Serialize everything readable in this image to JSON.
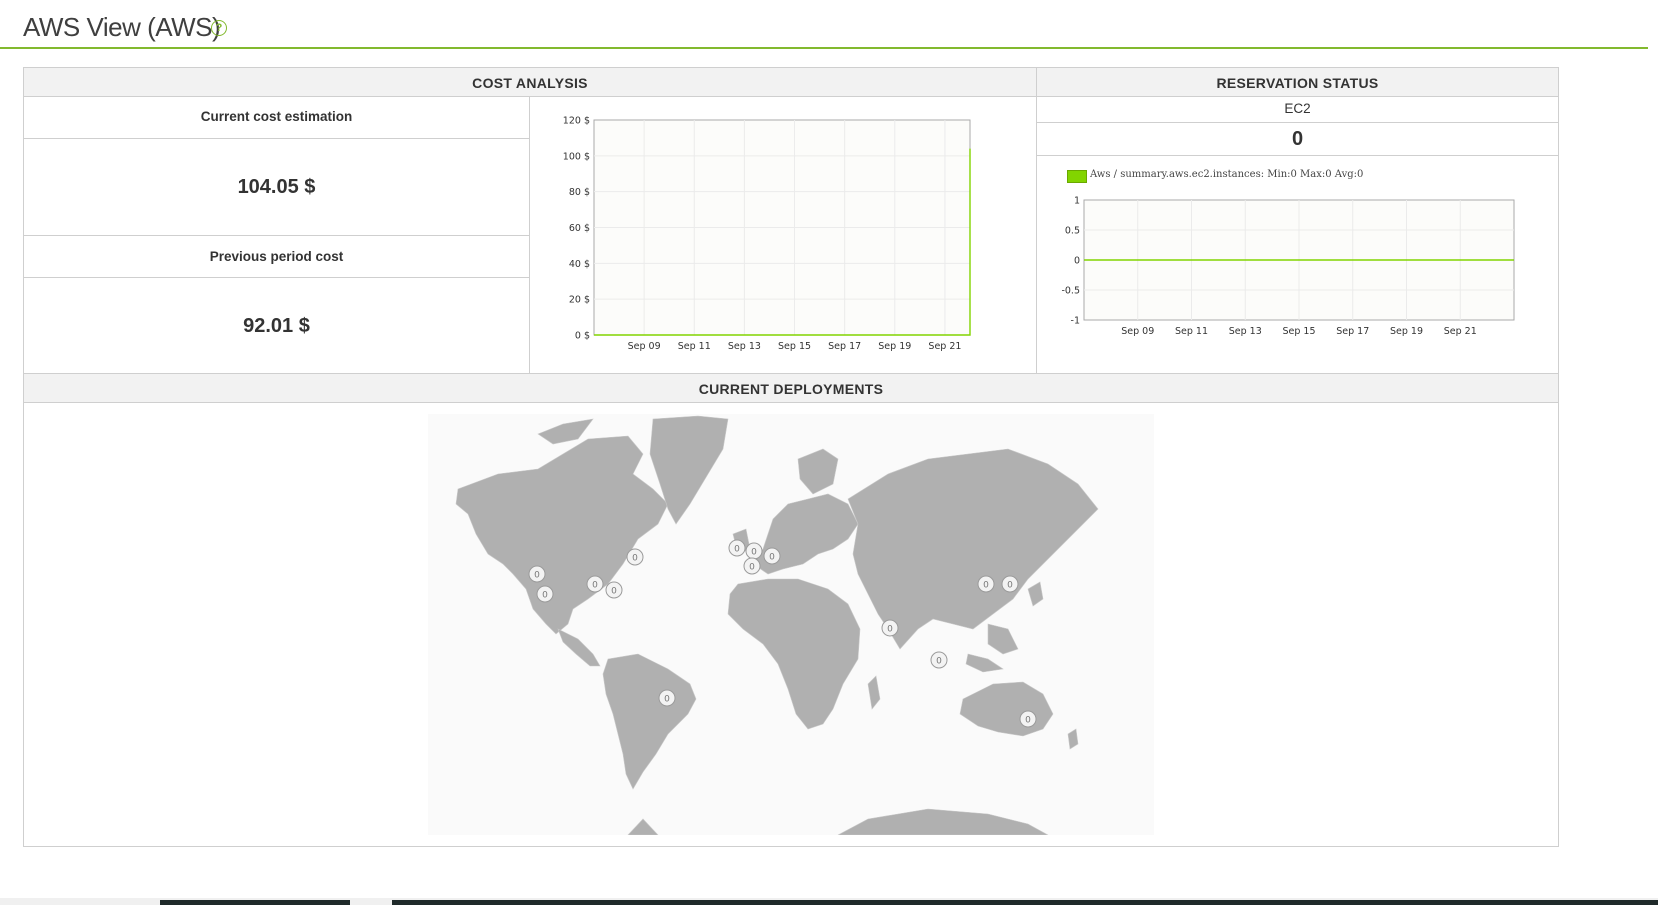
{
  "page": {
    "title": "AWS View (AWS)",
    "help_icon": "question-circle-icon"
  },
  "cost_analysis": {
    "header": "COST ANALYSIS",
    "current_label": "Current cost estimation",
    "current_value": "104.05 $",
    "previous_label": "Previous period cost",
    "previous_value": "92.01 $"
  },
  "reservation": {
    "header": "RESERVATION STATUS",
    "service": "EC2",
    "count": "0",
    "legend": "Aws / summary.aws.ec2.instances: Min:0 Max:0 Avg:0"
  },
  "deployments": {
    "header": "CURRENT DEPLOYMENTS",
    "marker_label": "0"
  },
  "colors": {
    "accent": "#82b92e",
    "line": "#82d400",
    "land": "#b0b0b0"
  },
  "chart_data": [
    {
      "type": "line",
      "title": "",
      "x_ticks": [
        "Sep 09",
        "Sep 11",
        "Sep 13",
        "Sep 15",
        "Sep 17",
        "Sep 19",
        "Sep 21"
      ],
      "y_ticks": [
        "0 $",
        "20 $",
        "40 $",
        "60 $",
        "80 $",
        "100 $",
        "120 $"
      ],
      "ylim": [
        0,
        120
      ],
      "xlim": [
        "Sep 07",
        "Sep 22"
      ],
      "series": [
        {
          "x": [
            "Sep 07",
            "Sep 21",
            "Sep 22",
            "Sep 22"
          ],
          "y": [
            0,
            0,
            0,
            104.05
          ]
        }
      ],
      "grid": true
    },
    {
      "type": "line",
      "title": "",
      "x_ticks": [
        "Sep 09",
        "Sep 11",
        "Sep 13",
        "Sep 15",
        "Sep 17",
        "Sep 19",
        "Sep 21"
      ],
      "y_ticks": [
        "-1",
        "-0.5",
        "0",
        "0.5",
        "1"
      ],
      "ylim": [
        -1,
        1
      ],
      "xlim": [
        "Sep 07",
        "Sep 23"
      ],
      "legend": "top-left",
      "series": [
        {
          "name": "Aws / summary.aws.ec2.instances: Min:0 Max:0 Avg:0",
          "x": [
            "Sep 07",
            "Sep 23"
          ],
          "y": [
            0,
            0
          ]
        }
      ],
      "grid": true
    }
  ]
}
